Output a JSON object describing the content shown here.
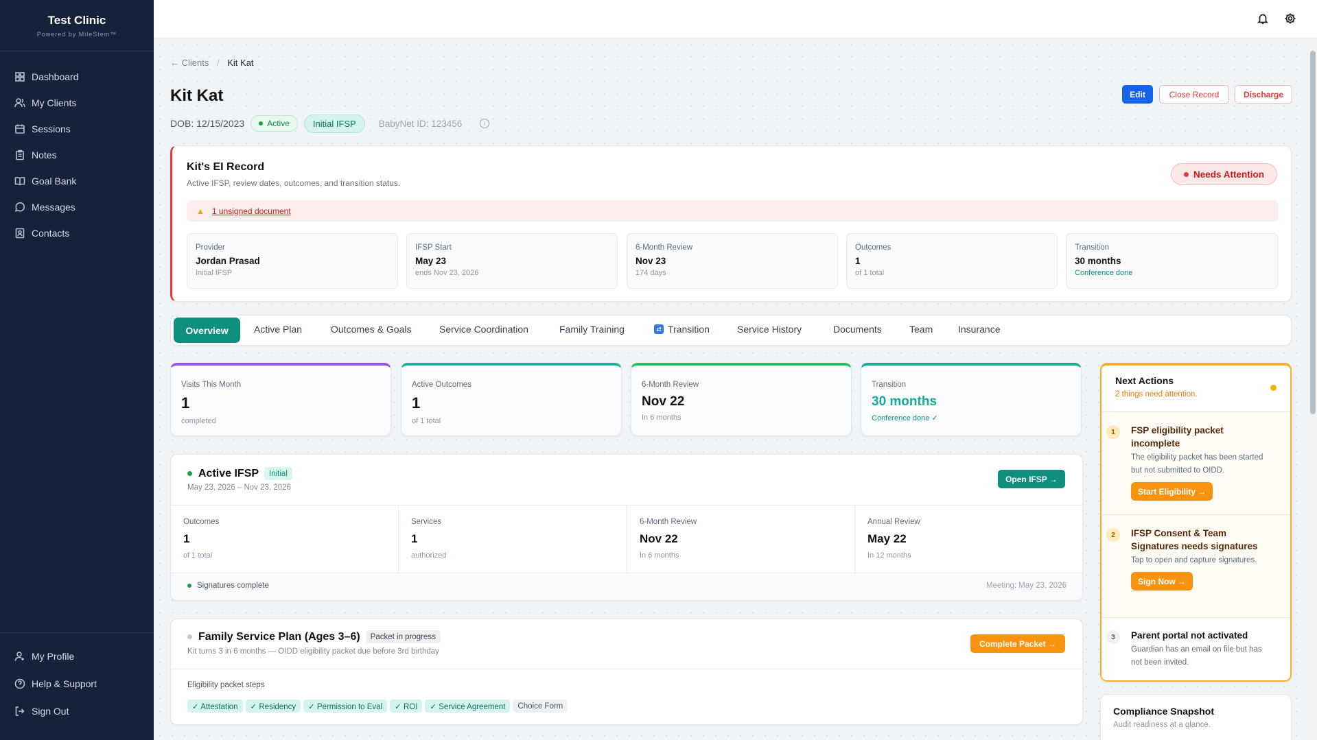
{
  "sidebar": {
    "brand": "Test Clinic",
    "powered": "Powered by MileStem™",
    "items": [
      {
        "label": "Dashboard",
        "icon": "grid-icon"
      },
      {
        "label": "My Clients",
        "icon": "users-icon"
      },
      {
        "label": "Sessions",
        "icon": "calendar-icon"
      },
      {
        "label": "Notes",
        "icon": "clipboard-icon"
      },
      {
        "label": "Goal Bank",
        "icon": "book-icon"
      },
      {
        "label": "Messages",
        "icon": "message-icon"
      },
      {
        "label": "Contacts",
        "icon": "contacts-icon"
      }
    ],
    "bottom": [
      {
        "label": "My Profile",
        "icon": "user-icon"
      },
      {
        "label": "Help & Support",
        "icon": "help-icon"
      },
      {
        "label": "Sign Out",
        "icon": "sign-out-icon"
      }
    ]
  },
  "breadcrumb": {
    "back": "← Clients",
    "sep": "/",
    "current": "Kit Kat"
  },
  "client": {
    "name": "Kit Kat",
    "dob": "DOB: 12/15/2023",
    "status": "Active",
    "phase": "Initial IFSP",
    "babynet": "BabyNet ID: 123456"
  },
  "actions": {
    "edit": "Edit",
    "close": "Close Record",
    "discharge": "Discharge"
  },
  "record": {
    "title": "Kit's EI Record",
    "subtitle": "Active IFSP, review dates, outcomes, and transition status.",
    "attention": "Needs Attention",
    "alert": "1 unsigned document",
    "cards": [
      {
        "label": "Provider",
        "value": "Jordan Prasad",
        "sub": "Initial IFSP"
      },
      {
        "label": "IFSP Start",
        "value": "May 23",
        "sub": "ends Nov 23, 2026"
      },
      {
        "label": "6-Month Review",
        "value": "Nov 23",
        "sub": "174 days"
      },
      {
        "label": "Outcomes",
        "value": "1",
        "sub": "of 1 total"
      },
      {
        "label": "Transition",
        "value": "30 months",
        "sub": "Conference done"
      }
    ]
  },
  "tabs": [
    "Overview",
    "Active Plan",
    "Outcomes & Goals",
    "Service Coordination",
    "Family Training",
    "Transition",
    "Service History",
    "Documents",
    "Team",
    "Insurance"
  ],
  "stats": [
    {
      "label": "Visits This Month",
      "value": "1",
      "sub": "completed",
      "color": "#9b4de0"
    },
    {
      "label": "Active Outcomes",
      "value": "1",
      "sub": "of 1 total",
      "color": "#1bb3a0"
    },
    {
      "label": "6-Month Review",
      "value": "Nov 22",
      "sub": "In 6 months",
      "color": "#22c55e"
    },
    {
      "label": "Transition",
      "value": "30 months",
      "sub": "Conference done ✓",
      "color": "#17a99a"
    }
  ],
  "ifsp": {
    "title": "Active IFSP",
    "badge": "Initial",
    "dates": "May 23, 2026 – Nov 23, 2026",
    "open": "Open IFSP →",
    "cols": [
      {
        "label": "Outcomes",
        "value": "1",
        "sub": "of 1 total"
      },
      {
        "label": "Services",
        "value": "1",
        "sub": "authorized"
      },
      {
        "label": "6-Month Review",
        "value": "Nov 22",
        "sub": "In 6 months"
      },
      {
        "label": "Annual Review",
        "value": "May 22",
        "sub": "In 12 months"
      }
    ],
    "signatures": "Signatures complete",
    "meeting": "Meeting: May 23, 2026"
  },
  "fsp": {
    "title": "Family Service Plan (Ages 3–6)",
    "badge": "Packet in progress",
    "desc": "Kit turns 3 in 6 months — OIDD eligibility packet due before 3rd birthday",
    "button": "Complete Packet →",
    "steps_label": "Eligibility packet steps",
    "steps": [
      "✓ Attestation",
      "✓ Residency",
      "✓ Permission to Eval",
      "✓ ROI",
      "✓ Service Agreement",
      "Choice Form"
    ]
  },
  "next_actions": {
    "title": "Next Actions",
    "subtitle": "2 things need attention.",
    "items": [
      {
        "num": "1",
        "title": "FSP eligibility packet incomplete",
        "desc": "The eligibility packet has been started but not submitted to OIDD.",
        "button": "Start Eligibility →"
      },
      {
        "num": "2",
        "title": "IFSP Consent & Team Signatures needs signatures",
        "desc": "Tap to open and capture signatures.",
        "button": "Sign Now →"
      },
      {
        "num": "3",
        "title": "Parent portal not activated",
        "desc": "Guardian has an email on file but has not been invited."
      }
    ]
  },
  "compliance": {
    "title": "Compliance Snapshot",
    "subtitle": "Audit readiness at a glance."
  },
  "colors": {
    "sidebar": "#15223a",
    "teal": "#0f8f7e",
    "blue": "#1463e8",
    "red": "#e23b3b",
    "orange": "#f7930f"
  }
}
